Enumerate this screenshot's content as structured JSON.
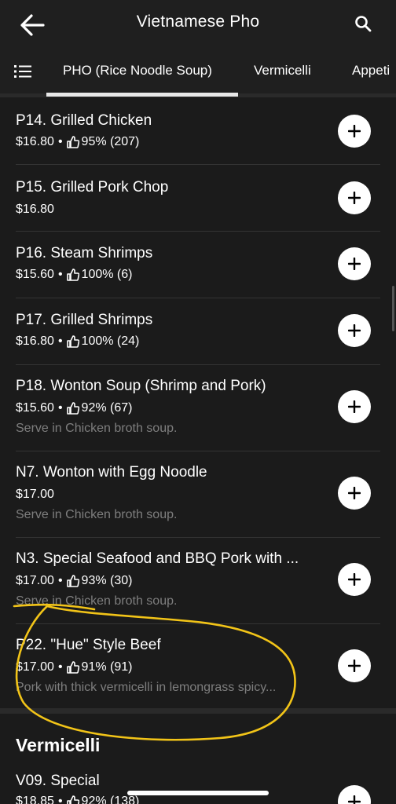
{
  "header": {
    "title": "Vietnamese Pho",
    "back_icon": "arrow-left-icon",
    "search_icon": "search-icon"
  },
  "tabs": {
    "menu_icon": "list-icon",
    "items": [
      {
        "label": "PHO (Rice Noodle Soup)",
        "selected": true
      },
      {
        "label": "Vermicelli",
        "selected": false
      },
      {
        "label": "Appeti",
        "selected": false
      }
    ]
  },
  "items": [
    {
      "name": "P14. Grilled Chicken",
      "price": "$16.80",
      "rating": "95% (207)",
      "desc": ""
    },
    {
      "name": "P15. Grilled Pork Chop",
      "price": "$16.80",
      "rating": "",
      "desc": ""
    },
    {
      "name": "P16. Steam Shrimps",
      "price": "$15.60",
      "rating": "100% (6)",
      "desc": ""
    },
    {
      "name": "P17. Grilled Shrimps",
      "price": "$16.80",
      "rating": "100% (24)",
      "desc": ""
    },
    {
      "name": "P18. Wonton Soup (Shrimp and Pork)",
      "price": "$15.60",
      "rating": "92% (67)",
      "desc": "Serve in Chicken broth soup."
    },
    {
      "name": "N7. Wonton with Egg Noodle",
      "price": "$17.00",
      "rating": "",
      "desc": "Serve in Chicken broth soup."
    },
    {
      "name": "N3. Special Seafood and BBQ Pork with ...",
      "price": "$17.00",
      "rating": "93% (30)",
      "desc": "Serve in Chicken broth soup."
    },
    {
      "name": "P22. \"Hue\" Style Beef",
      "price": "$17.00",
      "rating": "91% (91)",
      "desc": "Pork with thick vermicelli in lemongrass spicy..."
    },
    {
      "name": "V09. Special",
      "price": "$18.85",
      "rating": "92% (138)",
      "desc": ""
    }
  ],
  "section": {
    "title": "Vermicelli"
  },
  "separator": "•",
  "colors": {
    "annotation": "#f2c418",
    "background": "#1b1b1b",
    "muted": "#7e7e7e"
  }
}
